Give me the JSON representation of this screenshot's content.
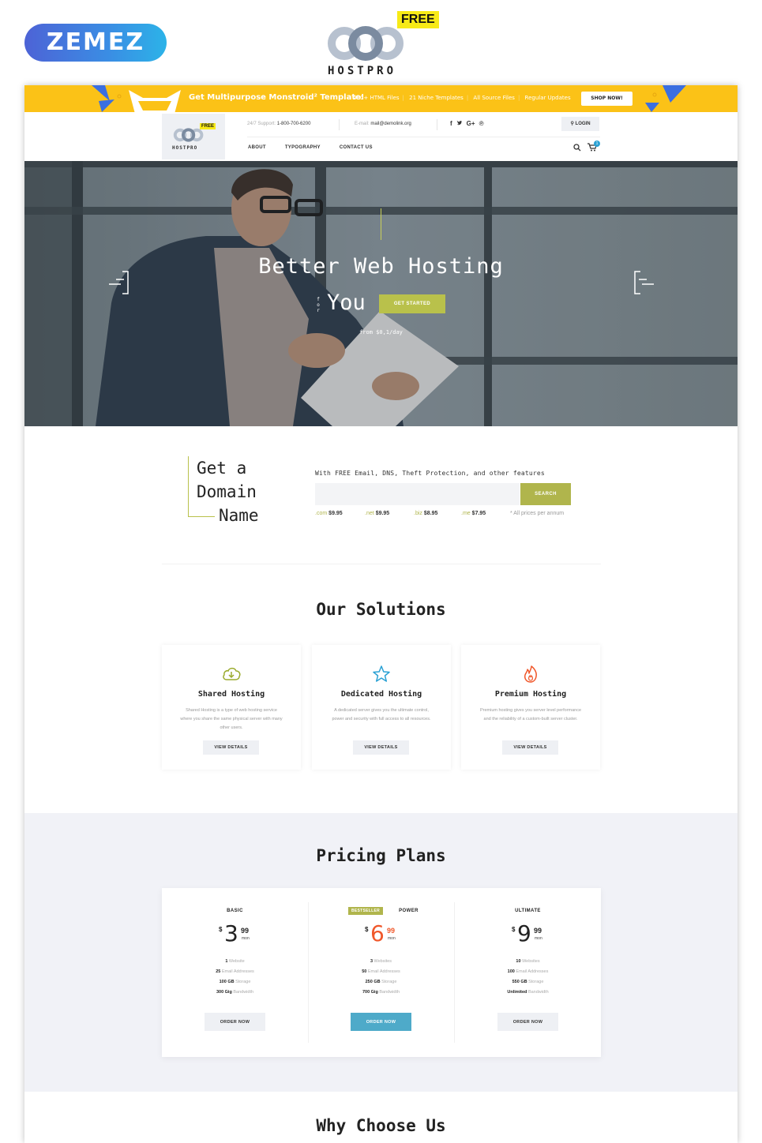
{
  "top_brand": {
    "vendor_logo": "ZEMEZ",
    "product_logo": "HOSTPRO",
    "product_badge": "FREE"
  },
  "promo_banner": {
    "headline": "Get Multipurpose Monstroid² Template!",
    "features": [
      "400+ HTML Files",
      "21 Niche Templates",
      "All Source Files",
      "Regular Updates"
    ],
    "cta_label": "SHOP NOW!",
    "colors": {
      "background": "#fbc217",
      "kite": "#3b6fe0"
    }
  },
  "header": {
    "logo_text": "HOSTPRO",
    "logo_badge": "FREE",
    "support_label": "24/7 Support:",
    "support_phone": "1-800-700-6200",
    "email_label": "E-mail:",
    "email_value": "mail@demolink.org",
    "social": [
      {
        "icon": "facebook-icon",
        "glyph": "f"
      },
      {
        "icon": "twitter-icon",
        "glyph": "🐦"
      },
      {
        "icon": "google-plus-icon",
        "glyph": "G+"
      },
      {
        "icon": "pinterest-icon",
        "glyph": "P"
      }
    ],
    "login_label": "LOGIN",
    "nav": [
      "ABOUT",
      "TYPOGRAPHY",
      "CONTACT US"
    ],
    "cart_count": "1"
  },
  "hero": {
    "headline_line1": "Better Web Hosting",
    "headline_for": "for",
    "headline_line2": "You",
    "cta_label": "GET STARTED",
    "subtext": "from $0,1/day",
    "accent_color": "#b9c14b"
  },
  "domain": {
    "title_lines": [
      "Get a",
      "Domain",
      "Name"
    ],
    "lead": "With FREE Email, DNS, Theft Protection, and other features",
    "input_value": "",
    "input_placeholder": "",
    "search_label": "SEARCH",
    "tlds": [
      {
        "ext": ".com",
        "price": "$9.95"
      },
      {
        "ext": ".net",
        "price": "$9.95"
      },
      {
        "ext": ".biz",
        "price": "$8.95"
      },
      {
        "ext": ".me",
        "price": "$7.95"
      }
    ],
    "note": "* All prices per annum"
  },
  "solutions": {
    "title": "Our Solutions",
    "cards": [
      {
        "icon": "cloud-download-icon",
        "icon_color": "#9aab2d",
        "title": "Shared Hosting",
        "description": "Shared Hosting is a type of web hosting service where you share the same physical server with many other users.",
        "button": "VIEW DETAILS"
      },
      {
        "icon": "star-icon",
        "icon_color": "#2aa1d4",
        "title": "Dedicated Hosting",
        "description": "A dedicated server gives you the ultimate control, power and security with full access to all resources.",
        "button": "VIEW DETAILS"
      },
      {
        "icon": "fire-icon",
        "icon_color": "#f0572a",
        "title": "Premium Hosting",
        "description": "Premium hosting gives you server level performance and the reliability of a custom-built server cluster.",
        "button": "VIEW DETAILS"
      }
    ]
  },
  "pricing": {
    "title": "Pricing Plans",
    "plans": [
      {
        "name": "BASIC",
        "badge": "",
        "currency": "$",
        "price_int": "3",
        "price_cents": "99",
        "period": "mon",
        "features": [
          {
            "value": "1",
            "label": "Website"
          },
          {
            "value": "25",
            "label": "Email Addresses"
          },
          {
            "value": "100 GB",
            "label": "Storage"
          },
          {
            "value": "300 Gig",
            "label": "Bandwidth"
          }
        ],
        "button": "ORDER NOW"
      },
      {
        "name": "POWER",
        "badge": "BESTSELLER",
        "currency": "$",
        "price_int": "6",
        "price_cents": "99",
        "period": "mon",
        "features": [
          {
            "value": "3",
            "label": "Websites"
          },
          {
            "value": "50",
            "label": "Email Addresses"
          },
          {
            "value": "250 GB",
            "label": "Storage"
          },
          {
            "value": "700 Gig",
            "label": "Bandwidth"
          }
        ],
        "button": "ORDER NOW"
      },
      {
        "name": "ULTIMATE",
        "badge": "",
        "currency": "$",
        "price_int": "9",
        "price_cents": "99",
        "period": "mon",
        "features": [
          {
            "value": "10",
            "label": "Websites"
          },
          {
            "value": "100",
            "label": "Email Addresses"
          },
          {
            "value": "550 GB",
            "label": "Storage"
          },
          {
            "value": "Unlimited",
            "label": "Bandwidth"
          }
        ],
        "button": "ORDER NOW"
      }
    ],
    "colors": {
      "featured_price": "#f0572a",
      "featured_button": "#4eaac9",
      "badge": "#b0b54c"
    }
  },
  "why": {
    "title": "Why Choose Us"
  }
}
